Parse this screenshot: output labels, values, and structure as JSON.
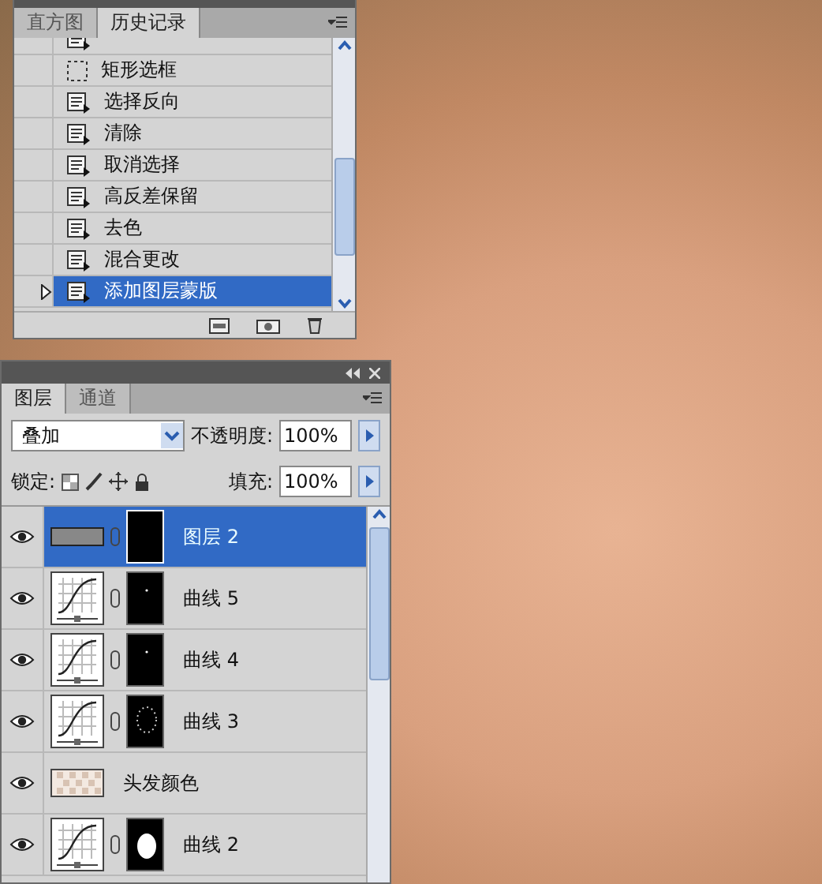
{
  "history_panel": {
    "tabs": [
      {
        "label": "直方图",
        "selected": false
      },
      {
        "label": "历史记录",
        "selected": true
      }
    ],
    "items": [
      {
        "kind": "step",
        "snapshot": false,
        "selected": false
      },
      {
        "label": "矩形选框",
        "kind": "selection",
        "snapshot": false,
        "selected": false
      },
      {
        "label": "选择反向",
        "kind": "step",
        "snapshot": false,
        "selected": false
      },
      {
        "label": "清除",
        "kind": "step",
        "snapshot": false,
        "selected": false
      },
      {
        "label": "取消选择",
        "kind": "step",
        "snapshot": false,
        "selected": false
      },
      {
        "label": "高反差保留",
        "kind": "step",
        "snapshot": false,
        "selected": false
      },
      {
        "label": "去色",
        "kind": "step",
        "snapshot": false,
        "selected": false
      },
      {
        "label": "混合更改",
        "kind": "step",
        "snapshot": false,
        "selected": false
      },
      {
        "label": "添加图层蒙版",
        "kind": "step",
        "snapshot": false,
        "selected": true
      }
    ]
  },
  "layers_panel": {
    "tabs": [
      {
        "label": "图层",
        "selected": true
      },
      {
        "label": "通道",
        "selected": false
      }
    ],
    "blend_mode": "叠加",
    "opacity_label": "不透明度:",
    "opacity": "100%",
    "lock_label": "锁定:",
    "fill_label": "填充:",
    "fill": "100%",
    "layers": [
      {
        "name": "图层 2",
        "kind": "fill",
        "visible": true,
        "selected": true
      },
      {
        "name": "曲线 5",
        "kind": "curves",
        "visible": true,
        "selected": false
      },
      {
        "name": "曲线 4",
        "kind": "curves",
        "visible": true,
        "selected": false
      },
      {
        "name": "曲线 3",
        "kind": "curves",
        "visible": true,
        "selected": false
      },
      {
        "name": "头发颜色",
        "kind": "pixel",
        "visible": true,
        "selected": false
      },
      {
        "name": "曲线 2",
        "kind": "curves",
        "visible": true,
        "selected": false
      }
    ]
  }
}
